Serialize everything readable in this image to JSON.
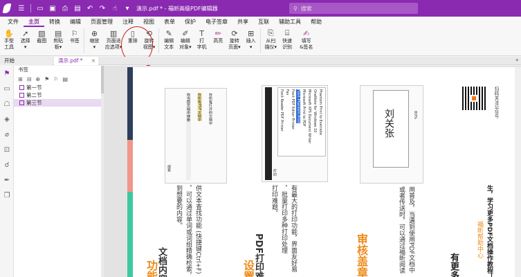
{
  "app": {
    "title": "演示.pdf * - 福昕高级PDF编辑器",
    "search_placeholder": "搜索",
    "accent": "#8a2ab0"
  },
  "menu": [
    "文件",
    "主页",
    "转换",
    "编辑",
    "页面管理",
    "注释",
    "视图",
    "表单",
    "保护",
    "电子签章",
    "共享",
    "互联",
    "辅助工具",
    "帮助"
  ],
  "ribbon": {
    "buttons": [
      {
        "label": "手型\n工具",
        "icon": "hand-icon"
      },
      {
        "label": "选择\n▾",
        "icon": "cursor-icon"
      },
      {
        "label": "截图",
        "icon": "screenshot-icon"
      },
      {
        "label": "剪贴\n板▾",
        "icon": "clipboard-icon"
      },
      {
        "label": "书签",
        "icon": "bookmark-icon"
      },
      {
        "label": "缩放\n▾",
        "icon": "zoom-icon"
      },
      {
        "label": "页面适\n应选项▾",
        "icon": "fit-page-icon"
      },
      {
        "label": "重排",
        "icon": "reflow-icon"
      },
      {
        "label": "旋转\n视图▾",
        "icon": "rotate-view-icon"
      },
      {
        "label": "编辑\n文本",
        "icon": "edit-text-icon"
      },
      {
        "label": "编辑\n对象▾",
        "icon": "edit-object-icon"
      },
      {
        "label": "打\n字机",
        "icon": "typewriter-icon"
      },
      {
        "label": "高亮",
        "icon": "highlight-icon"
      },
      {
        "label": "旋转\n页面▾",
        "icon": "rotate-page-icon"
      },
      {
        "label": "插入\n▾",
        "icon": "insert-icon"
      },
      {
        "label": "从扫\n描仪▾",
        "icon": "scanner-icon"
      },
      {
        "label": "快速\n识别",
        "icon": "ocr-icon"
      },
      {
        "label": "填写\n&签名",
        "icon": "sign-icon"
      }
    ]
  },
  "tabs": {
    "start": "开始",
    "doc": "演示.pdf *"
  },
  "bookmarks": {
    "header": "书签",
    "items": [
      "第一节",
      "第二节",
      "第三节"
    ],
    "selected": 2
  },
  "page": {
    "col1_heading": "功能",
    "col1_sub": "文档内容",
    "col1_l1": "供文本查找功能 (快捷键Ctrl+F)",
    "col1_l2": "，可以通过单词或词组精确检索，",
    "col1_l3": "到想要的内容。",
    "ss1_title": "搜索",
    "ss1_lines": [
      "在当前文档中搜索",
      "在所有PDF文档中",
      "在所有打开的文档中"
    ],
    "col2_heading": "设置",
    "col2_sub": "PDF打印难题",
    "col2_l1": "有最大的打印功能，界面友好易",
    "col2_l2": "，批量打印多种打印处理",
    "col2_l3": "打印难题。",
    "ss2_lines": [
      "Foxit Reader PDF Printer",
      "Fax",
      "Foxit PDF Editor Printer",
      "Foxit Phantom Print",
      "Microsoft Print to PDF",
      "Microsoft XPS Document Writer",
      "OneNote for Windows 10",
      "Phantom Print to Evernote"
    ],
    "ss2_head": "打印",
    "col3_heading": "审核盖章",
    "col3_l1": "用普及，当遇到使用PDF文档中",
    "col3_l2": "或者传送时，可以通过福昕阅读",
    "col3_name": "刘关张",
    "col3_zoom": "80%",
    "col4_heading": "有更多",
    "col4_l1": "生，学习更多PDF文档操作教程！",
    "col4_l2": "福昕帮助中心",
    "col4_qr_caption": "扫码关注公众号"
  }
}
